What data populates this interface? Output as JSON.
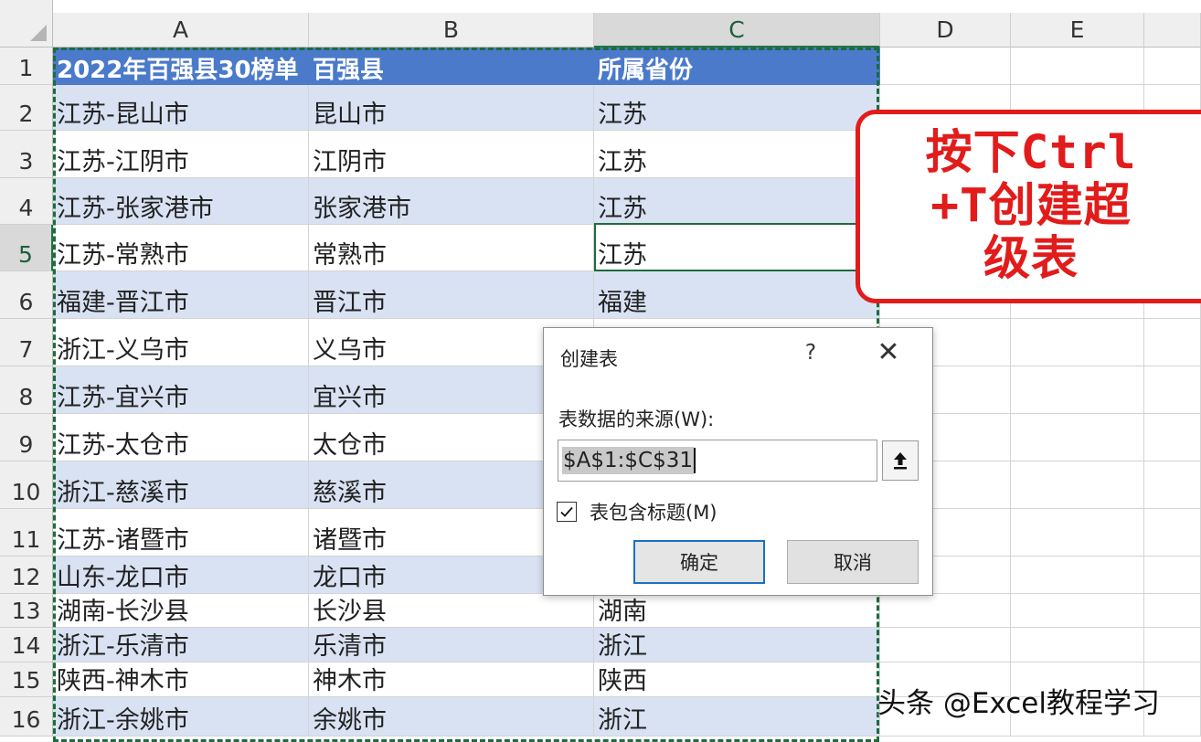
{
  "columns": [
    "A",
    "B",
    "C",
    "D",
    "E"
  ],
  "selected_column": "C",
  "selected_row": "5",
  "rows": [
    {
      "n": "1",
      "a": "2022年百强县30榜单",
      "b": "百强县",
      "c": "所属省份",
      "header": true
    },
    {
      "n": "2",
      "a": "江苏-昆山市",
      "b": "昆山市",
      "c": "江苏"
    },
    {
      "n": "3",
      "a": "江苏-江阴市",
      "b": "江阴市",
      "c": "江苏"
    },
    {
      "n": "4",
      "a": "江苏-张家港市",
      "b": "张家港市",
      "c": "江苏"
    },
    {
      "n": "5",
      "a": "江苏-常熟市",
      "b": "常熟市",
      "c": "江苏"
    },
    {
      "n": "6",
      "a": "福建-晋江市",
      "b": "晋江市",
      "c": "福建"
    },
    {
      "n": "7",
      "a": "浙江-义乌市",
      "b": "义乌市",
      "c": ""
    },
    {
      "n": "8",
      "a": "江苏-宜兴市",
      "b": "宜兴市",
      "c": ""
    },
    {
      "n": "9",
      "a": "江苏-太仓市",
      "b": "太仓市",
      "c": ""
    },
    {
      "n": "10",
      "a": "浙江-慈溪市",
      "b": "慈溪市",
      "c": ""
    },
    {
      "n": "11",
      "a": "江苏-诸暨市",
      "b": "诸暨市",
      "c": ""
    },
    {
      "n": "12",
      "a": "山东-龙口市",
      "b": "龙口市",
      "c": ""
    },
    {
      "n": "13",
      "a": "湖南-长沙县",
      "b": "长沙县",
      "c": "湖南"
    },
    {
      "n": "14",
      "a": "浙江-乐清市",
      "b": "乐清市",
      "c": "浙江"
    },
    {
      "n": "15",
      "a": "陕西-神木市",
      "b": "神木市",
      "c": "陕西"
    },
    {
      "n": "16",
      "a": "浙江-余姚市",
      "b": "余姚市",
      "c": "浙江"
    }
  ],
  "callout": {
    "line1": "按下Ctrl",
    "line2": "+T创建超",
    "line3": "级表"
  },
  "dialog": {
    "title": "创建表",
    "help": "?",
    "close": "✕",
    "source_label": "表数据的来源(W):",
    "range_value": "$A$1:$C$31",
    "checkbox_checked": true,
    "checkbox_label": "表包含标题(M)",
    "ok_label": "确定",
    "cancel_label": "取消"
  },
  "watermark": "头条 @Excel教程学习",
  "colors": {
    "table_header": "#4a7ac9",
    "band": "#d9e2f3",
    "callout": "#e21b1b",
    "selection": "#1e6b3e"
  }
}
